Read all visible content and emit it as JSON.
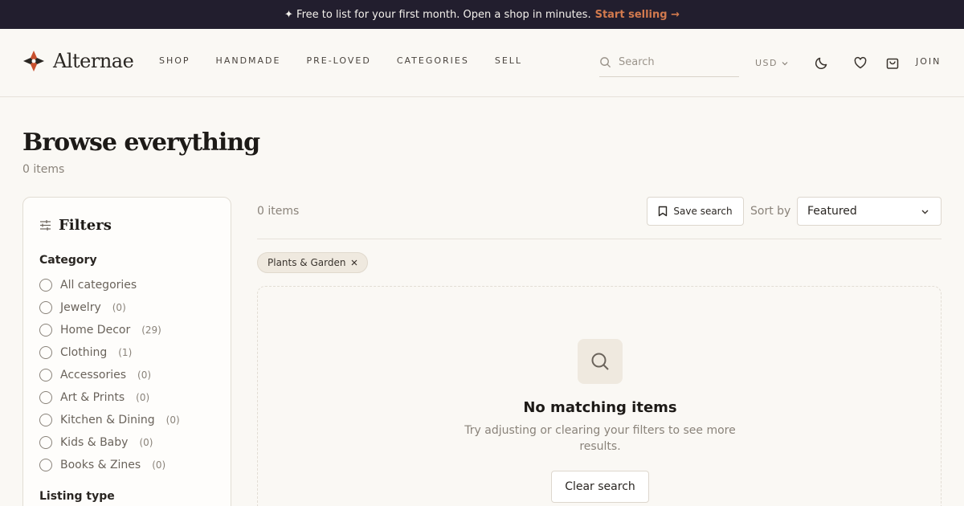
{
  "promo": {
    "text": "✦ Free to list for your first month. Open a shop in minutes.",
    "cta": "Start selling →"
  },
  "header": {
    "brand": "Alternae",
    "nav": [
      "SHOP",
      "HANDMADE",
      "PRE-LOVED",
      "CATEGORIES",
      "SELL"
    ],
    "search_placeholder": "Search",
    "currency": "USD",
    "join": "JOIN",
    "icons": [
      "moon-icon",
      "heart-icon",
      "bag-icon"
    ]
  },
  "page": {
    "title": "Browse everything",
    "count": "0 items"
  },
  "filters": {
    "title": "Filters",
    "category_title": "Category",
    "categories": [
      {
        "label": "All categories",
        "count": ""
      },
      {
        "label": "Jewelry",
        "count": "(0)"
      },
      {
        "label": "Home Decor",
        "count": "(29)"
      },
      {
        "label": "Clothing",
        "count": "(1)"
      },
      {
        "label": "Accessories",
        "count": "(0)"
      },
      {
        "label": "Art & Prints",
        "count": "(0)"
      },
      {
        "label": "Kitchen & Dining",
        "count": "(0)"
      },
      {
        "label": "Kids & Baby",
        "count": "(0)"
      },
      {
        "label": "Books & Zines",
        "count": "(0)"
      }
    ],
    "listing_type_title": "Listing type"
  },
  "results": {
    "count": "0 items",
    "save_search": "Save search",
    "sort_label": "Sort by",
    "sort_value": "Featured",
    "active_chip": "Plants & Garden"
  },
  "empty_state": {
    "title": "No matching items",
    "text": "Try adjusting or clearing your filters to see more results.",
    "clear_button": "Clear search"
  },
  "colors": {
    "promo_bg": "#221e2e",
    "accent": "#d27a4e",
    "page_bg": "#faf8f4"
  }
}
